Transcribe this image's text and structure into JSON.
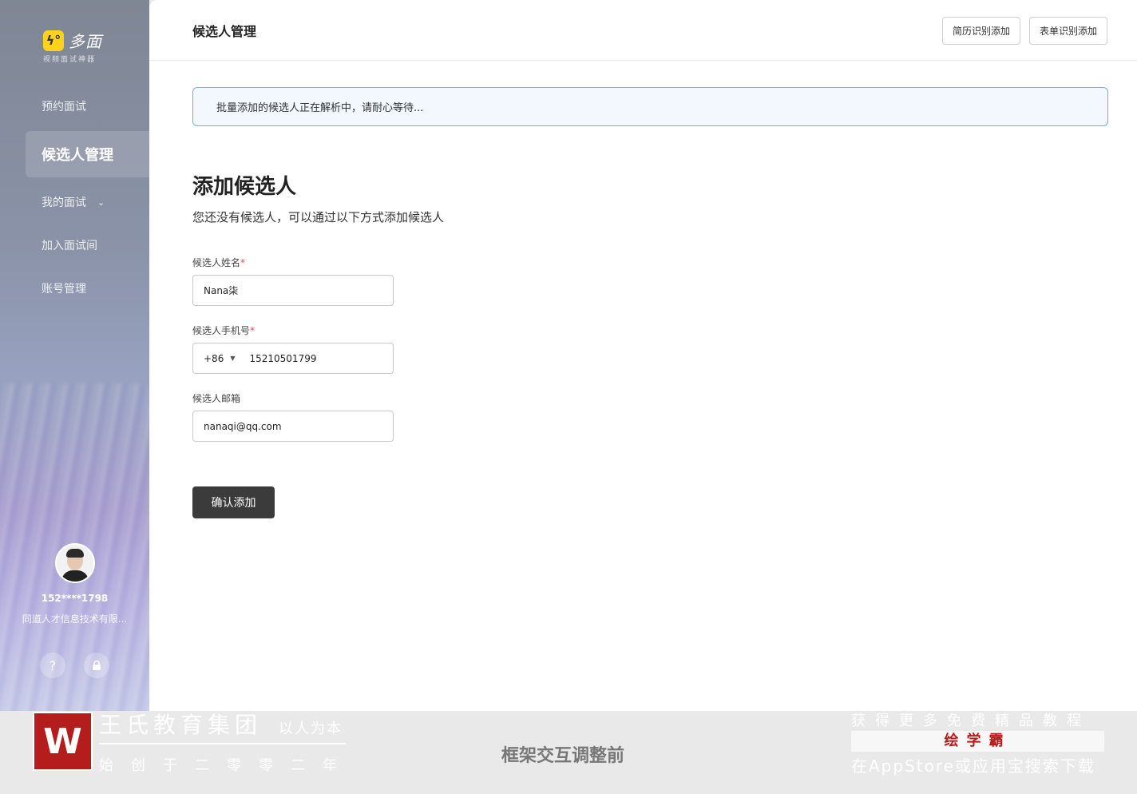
{
  "sidebar": {
    "logo_mark": "ϟ°",
    "logo_text": "多面",
    "logo_subtitle": "视频面试神器",
    "nav": [
      {
        "label": "预约面试"
      },
      {
        "label": "候选人管理"
      },
      {
        "label": "我的面试"
      },
      {
        "label": "加入面试间"
      },
      {
        "label": "账号管理"
      }
    ],
    "user": {
      "phone": "152****1798",
      "company": "同道人才信息技术有限..."
    }
  },
  "header": {
    "title": "候选人管理",
    "btn_resume": "简历识别添加",
    "btn_form": "表单识别添加"
  },
  "notice": "批量添加的候选人正在解析中，请耐心等待...",
  "form": {
    "title": "添加候选人",
    "subtitle": "您还没有候选人，可以通过以下方式添加候选人",
    "name_label": "候选人姓名",
    "name_value": "Nana柒",
    "phone_label": "候选人手机号",
    "country_code": "+86",
    "phone_value": "15210501799",
    "email_label": "候选人邮箱",
    "email_value": "nanaqi@qq.com",
    "required_mark": "*",
    "submit": "确认添加"
  },
  "watermark": {
    "logo_letter": "W",
    "name": "王氏教育集团",
    "slogan": "以人为本",
    "founded": "始创于二零零二年",
    "caption": "框架交互调整前",
    "promo_line1": "获得更多免费精品教程",
    "promo_brand": "绘学霸",
    "promo_line2": "在AppStore或应用宝搜索下载"
  }
}
